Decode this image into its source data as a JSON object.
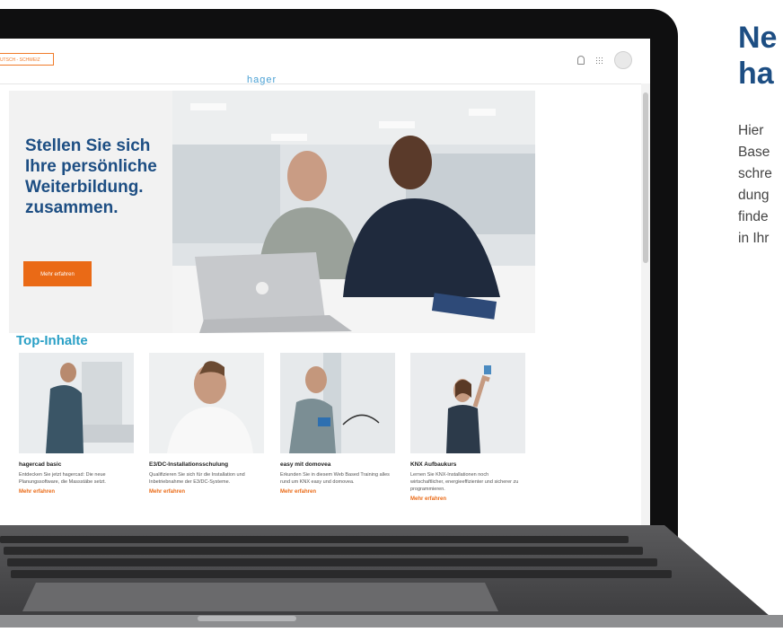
{
  "topbar": {
    "language": "DEUTSCH - SCHWEIZ",
    "logo": "hager"
  },
  "hero": {
    "title": "Stellen Sie sich Ihre persönliche Weiterbildung. zusammen.",
    "button": "Mehr erfahren"
  },
  "section_title": "Top-Inhalte",
  "cards": [
    {
      "title": "hagercad basic",
      "desc": "Entdecken Sie jetzt hagercad: Die neue Planungssoftware, die Massstäbe setzt.",
      "link": "Mehr erfahren"
    },
    {
      "title": "E3/DC-Installationsschulung",
      "desc": "Qualifizieren Sie sich für die Installation und Inbetriebnahme der E3/DC-Systeme.",
      "link": "Mehr erfahren"
    },
    {
      "title": "easy mit domovea",
      "desc": "Erkunden Sie in diesem Web Based Training alles rund um KNX easy und domovea.",
      "link": "Mehr erfahren"
    },
    {
      "title": "KNX Aufbaukurs",
      "desc": "Lernen Sie KNX-Installationen noch wirtschaftlicher, energieeffizienter und sicherer zu programmieren.",
      "link": "Mehr erfahren"
    }
  ],
  "side": {
    "title": "Ne\nha",
    "text_lines": [
      "Hier",
      "Base",
      "schre",
      "dung",
      "finde",
      "in Ihr"
    ]
  },
  "colors": {
    "brand_blue": "#1d4e83",
    "accent_orange": "#ea6a16",
    "teal": "#2aa0c6"
  }
}
